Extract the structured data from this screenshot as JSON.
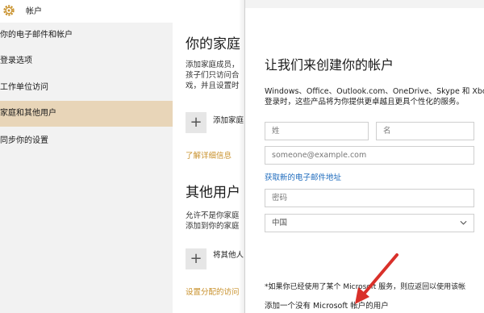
{
  "window": {
    "title": "帐户"
  },
  "sidebar": {
    "items": [
      {
        "label": "你的电子邮件和帐户"
      },
      {
        "label": "登录选项"
      },
      {
        "label": "工作单位访问"
      },
      {
        "label": "家庭和其他用户"
      },
      {
        "label": "同步你的设置"
      }
    ]
  },
  "family": {
    "heading": "你的家庭",
    "description": "添加家庭成员，\n孩子们只访问合\n戏，并且设置时",
    "add_label": "添加家庭",
    "learn_more": "了解详细信息"
  },
  "other_users": {
    "heading": "其他用户",
    "description": "允许不是你家庭\n添加到你的家庭",
    "add_label": "将其他人",
    "assigned_access": "设置分配的访问"
  },
  "dialog": {
    "title": "让我们来创建你的帐户",
    "description": "Windows、Office、Outlook.com、OneDrive、Skype 和 Xbox\n登录时，这些产品将为你提供更卓越且更具个性化的服务。",
    "last_name_placeholder": "姓",
    "first_name_placeholder": "名",
    "email_placeholder": "someone@example.com",
    "get_email_link": "获取新的电子邮件地址",
    "password_placeholder": "密码",
    "country_value": "中国",
    "footnote": "*如果你已经使用了某个 Microsoft 服务，则应返回以使用该帐",
    "no_account_link": "添加一个没有 Microsoft 帐户的用户"
  },
  "colors": {
    "sidebar_active": "#e8d5b8",
    "accent_link": "#c8902a",
    "blue_link": "#1e6bbd",
    "annotation_arrow": "#d9302a"
  }
}
